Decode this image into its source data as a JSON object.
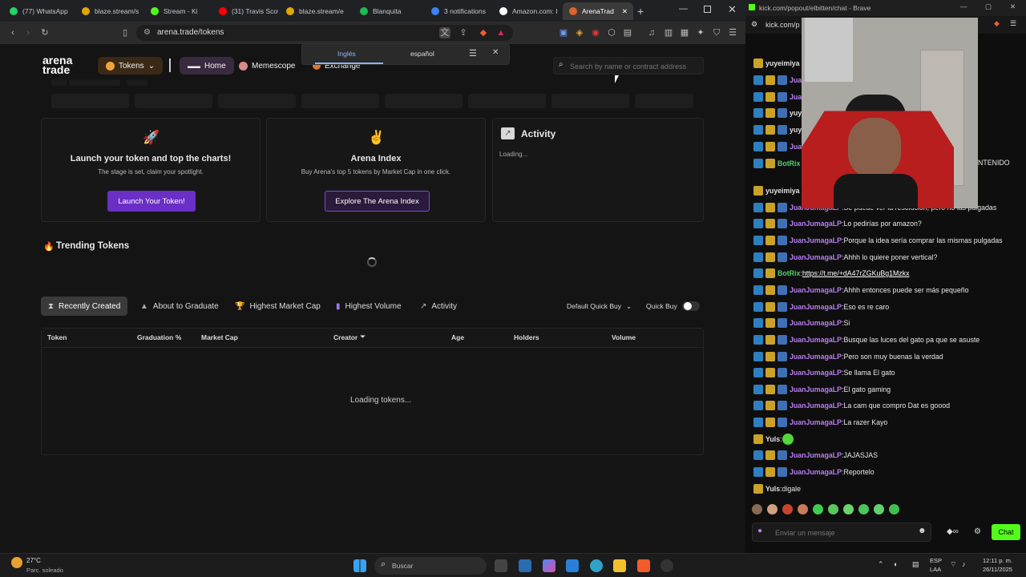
{
  "browser_tabs": [
    {
      "label": "(77) WhatsApp",
      "color": "#25d366"
    },
    {
      "label": "blaze.stream/s",
      "color": "#e0a800"
    },
    {
      "label": "Stream - Ki",
      "color": "#53fc18"
    },
    {
      "label": "(31) Travis Scot",
      "color": "#ff0000"
    },
    {
      "label": "blaze.stream/e",
      "color": "#e0a800"
    },
    {
      "label": "Blanquita",
      "color": "#1db954"
    },
    {
      "label": "3 notifications",
      "color": "#3b82f6"
    },
    {
      "label": "Amazon.com: I",
      "color": "#ffffff"
    },
    {
      "label": "ArenaTrad",
      "color": "#e0622c",
      "active": true
    }
  ],
  "url": "arena.trade/tokens",
  "translate": {
    "lang1": "Inglés",
    "lang2": "español"
  },
  "nav": {
    "logo_line1": "arena",
    "logo_line2": "trade",
    "tokens": "Tokens",
    "home": "Home",
    "memescope": "Memescope",
    "exchange": "Exchange",
    "search_placeholder": "Search by name or contract address"
  },
  "cards": {
    "launch_title": "Launch your token and top the charts!",
    "launch_sub": "The stage is set, claim your spotlight.",
    "launch_btn": "Launch Your Token!",
    "index_title": "Arena Index",
    "index_sub": "Buy Arena's top 5 tokens by Market Cap in one click.",
    "index_btn": "Explore The Arena Index",
    "activity_title": "Activity",
    "activity_loading": "Loading..."
  },
  "trending": "Trending Tokens",
  "filters": [
    "Recently Created",
    "About to Graduate",
    "Highest Market Cap",
    "Highest Volume",
    "Activity"
  ],
  "quick_buy_select": "Default Quick Buy",
  "quick_buy": "Quick Buy",
  "table_headers": [
    "Token",
    "Graduation %",
    "Market Cap",
    "Creator",
    "Age",
    "Holders",
    "Volume"
  ],
  "loading_tokens": "Loading tokens...",
  "chat_window": {
    "title": "kick.com/popout/elbitten/chat - Brave",
    "url": "kick.com/p",
    "partial_text": "NTENIDO",
    "messages": [
      {
        "user": "yuyeimiya",
        "text": "",
        "badges": "y"
      },
      {
        "user": "Jua",
        "text": "",
        "badges": "abc"
      },
      {
        "user": "Jua",
        "text": "",
        "badges": "abc"
      },
      {
        "user": "yuyeimiya",
        "text": "",
        "badges": "abc"
      },
      {
        "user": "yuyeimiya",
        "text": "",
        "badges": "abc"
      },
      {
        "user": "Jua",
        "text": "",
        "badges": "abc"
      },
      {
        "user": "BotRix",
        "text": "",
        "badges": "abot"
      },
      {
        "user": "yuyeimiya",
        "text": "",
        "badges": "y"
      },
      {
        "user": "JuanJumagaLP",
        "text": "Se puede ver la resolución, pero no las pulgadas",
        "badges": "abc"
      },
      {
        "user": "JuanJumagaLP",
        "text": "Lo pedirías por amazon?",
        "badges": "abc"
      },
      {
        "user": "JuanJumagaLP",
        "text": "Porque la idea sería comprar las mismas pulgadas",
        "badges": "abc"
      },
      {
        "user": "JuanJumagaLP",
        "text": "Ahhh lo quiere poner vertical?",
        "badges": "abc"
      },
      {
        "user": "BotRix",
        "text": "https://t.me/+dA47rZGKuBg1Mzkx",
        "badges": "abot",
        "link": true
      },
      {
        "user": "JuanJumagaLP",
        "text": "Ahhh entonces puede ser más pequeño",
        "badges": "abc"
      },
      {
        "user": "JuanJumagaLP",
        "text": "Eso es re caro",
        "badges": "abc"
      },
      {
        "user": "JuanJumagaLP",
        "text": "Si",
        "badges": "abc"
      },
      {
        "user": "JuanJumagaLP",
        "text": "Busque las luces del gato pa que se asuste",
        "badges": "abc"
      },
      {
        "user": "JuanJumagaLP",
        "text": "Pero son muy buenas la verdad",
        "badges": "abc"
      },
      {
        "user": "JuanJumagaLP",
        "text": "Se llama El gato",
        "badges": "abc"
      },
      {
        "user": "JuanJumagaLP",
        "text": "El gato gaming",
        "badges": "abc"
      },
      {
        "user": "JuanJumagaLP",
        "text": "La cam que compro Dat es goood",
        "badges": "abc"
      },
      {
        "user": "JuanJumagaLP",
        "text": "La razer Kayo",
        "badges": "abc"
      },
      {
        "user": "Yuls",
        "text": "",
        "badges": "y",
        "emote": true
      },
      {
        "user": "JuanJumagaLP",
        "text": "JAJASJAS",
        "badges": "abc"
      },
      {
        "user": "JuanJumagaLP",
        "text": "Reportelo",
        "badges": "abc"
      },
      {
        "user": "Yuls",
        "text": "digale",
        "badges": "y"
      }
    ],
    "input_placeholder": "Enviar un mensaje",
    "chat_btn": "Chat"
  },
  "taskbar": {
    "weather_temp": "27°C",
    "weather_desc": "Parc. soleado",
    "search": "Buscar",
    "lang1": "ESP",
    "lang2": "LAA",
    "time": "12:11 p. m.",
    "date": "26/11/2025"
  }
}
